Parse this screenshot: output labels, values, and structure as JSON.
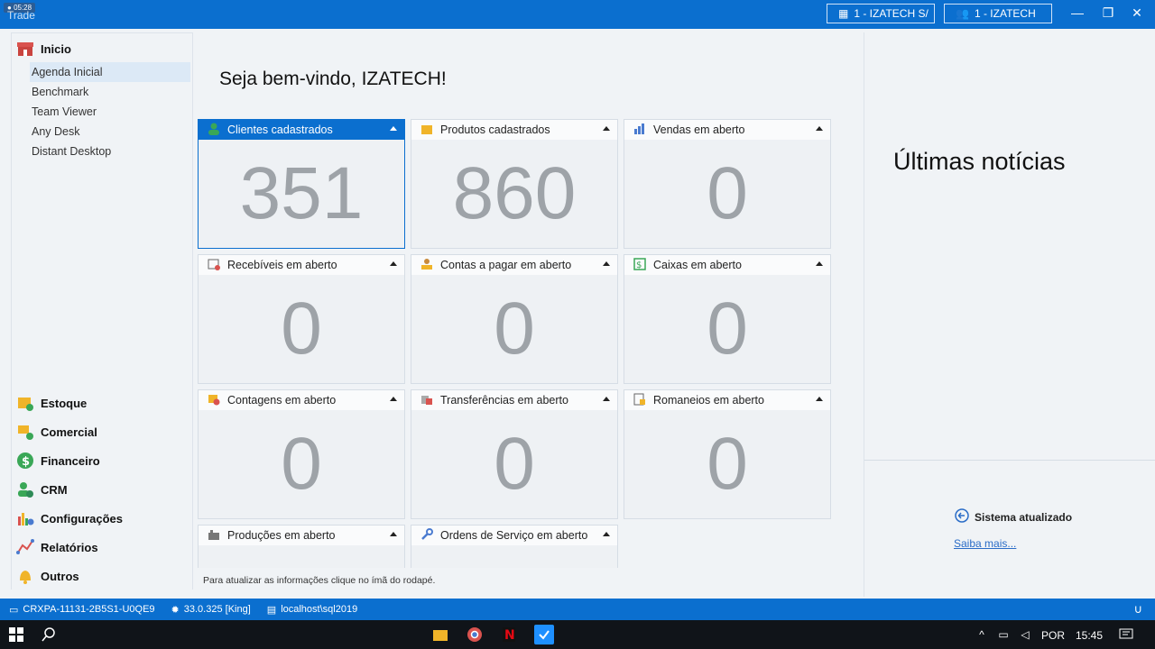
{
  "titlebar": {
    "app_title": "Trade",
    "rec_time": "05:28",
    "company_btn": "1 - IZATECH S/",
    "user_btn": "1 - IZATECH"
  },
  "sidebar": {
    "home": {
      "label": "Inicio",
      "items": [
        "Agenda Inicial",
        "Benchmark",
        "Team Viewer",
        "Any Desk",
        "Distant Desktop"
      ]
    },
    "sections": [
      "Estoque",
      "Comercial",
      "Financeiro",
      "CRM",
      "Configurações",
      "Relatórios",
      "Outros"
    ]
  },
  "main": {
    "welcome": "Seja bem-vindo, IZATECH!",
    "cards": [
      {
        "title": "Clientes cadastrados",
        "value": "351",
        "icon": "user-icon"
      },
      {
        "title": "Produtos cadastrados",
        "value": "860",
        "icon": "box-icon"
      },
      {
        "title": "Vendas em aberto",
        "value": "0",
        "icon": "chart-icon"
      },
      {
        "title": "Recebíveis em aberto",
        "value": "0",
        "icon": "receivable-icon"
      },
      {
        "title": "Contas a pagar em aberto",
        "value": "0",
        "icon": "payable-icon"
      },
      {
        "title": "Caixas em aberto",
        "value": "0",
        "icon": "cash-icon"
      },
      {
        "title": "Contagens em aberto",
        "value": "0",
        "icon": "tag-icon"
      },
      {
        "title": "Transferências em aberto",
        "value": "0",
        "icon": "transfer-icon"
      },
      {
        "title": "Romaneios em aberto",
        "value": "0",
        "icon": "list-icon"
      },
      {
        "title": "Produções em aberto",
        "value": "",
        "icon": "factory-icon"
      },
      {
        "title": "Ordens de Serviço em aberto",
        "value": "",
        "icon": "wrench-icon"
      }
    ],
    "hint": "Para atualizar as informações clique no ímã do rodapé."
  },
  "news": {
    "title": "Últimas notícias",
    "update_label": "Sistema atualizado",
    "link": "Saiba mais..."
  },
  "status": {
    "machine": "CRXPA-11131-2B5S1-U0QE9",
    "version": "33.0.325 [King]",
    "server": "localhost\\sql2019"
  },
  "taskbar": {
    "lang": "POR",
    "time": "15:45"
  },
  "colors": {
    "accent": "#0b6fcf",
    "value": "#9ea3a8"
  }
}
